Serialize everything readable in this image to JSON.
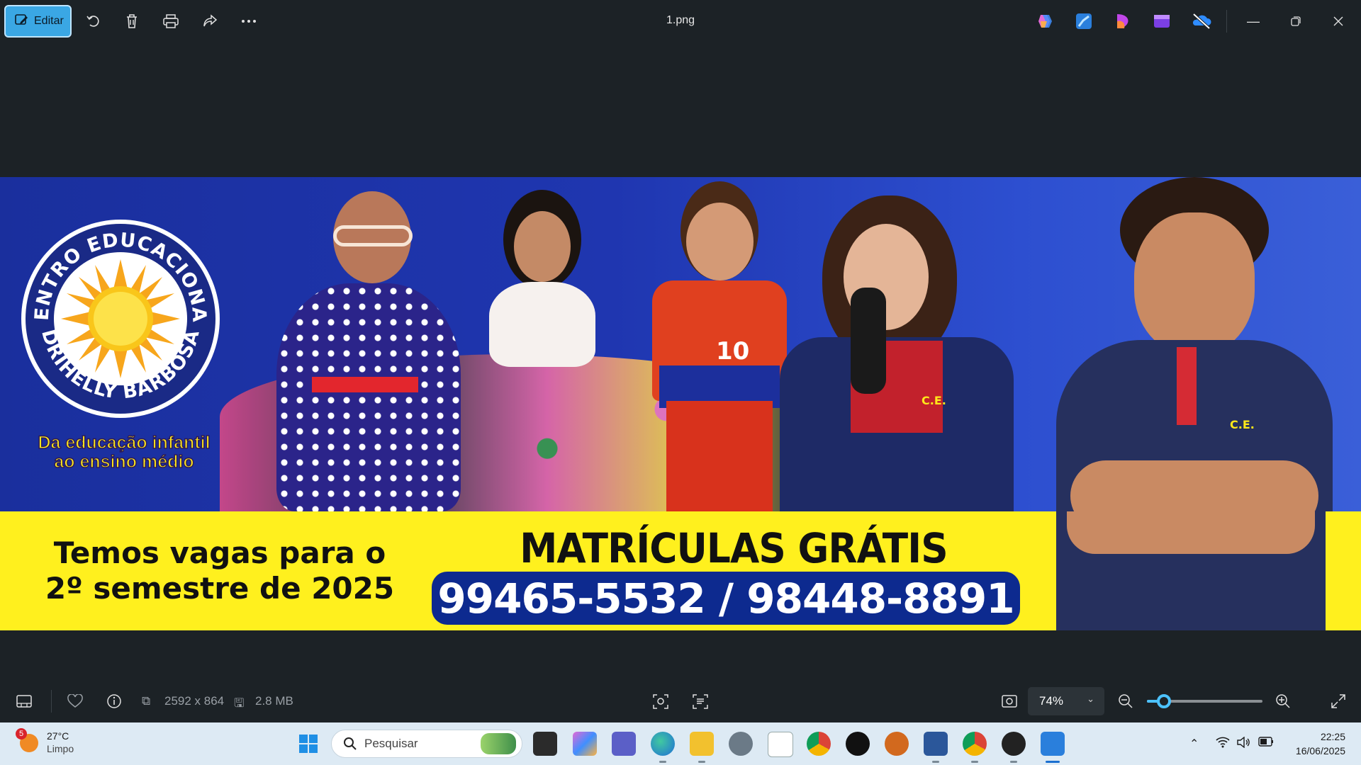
{
  "toolbar": {
    "edit_label": "Editar",
    "file_title": "1.png"
  },
  "banner": {
    "logo_ring_top": "CENTRO EDUCACIONAL",
    "logo_ring_bottom": "DRIHELLY BARBOSA",
    "logo_tag_line1": "Da educação infantil",
    "logo_tag_line2": "ao ensino médio",
    "jersey_number": "10",
    "badge_text": "C.E.",
    "left_line1": "Temos vagas para o",
    "left_line2": "2º semestre de 2025",
    "headline": "MATRÍCULAS GRÁTIS",
    "phones": "99465-5532 / 98448-8891"
  },
  "statusbar": {
    "dimensions": "2592 x 864",
    "file_size": "2.8 MB",
    "zoom": "74%",
    "zoom_fraction": 0.15
  },
  "taskbar": {
    "weather_temp": "27°C",
    "weather_cond": "Limpo",
    "weather_badge": "5",
    "search_placeholder": "Pesquisar",
    "time": "22:25",
    "date": "16/06/2025"
  },
  "colors": {
    "accent": "#3aa7e4",
    "banner_blue": "#1f36b0",
    "banner_yellow": "#fff01e",
    "pill_blue": "#0d2a8f"
  }
}
